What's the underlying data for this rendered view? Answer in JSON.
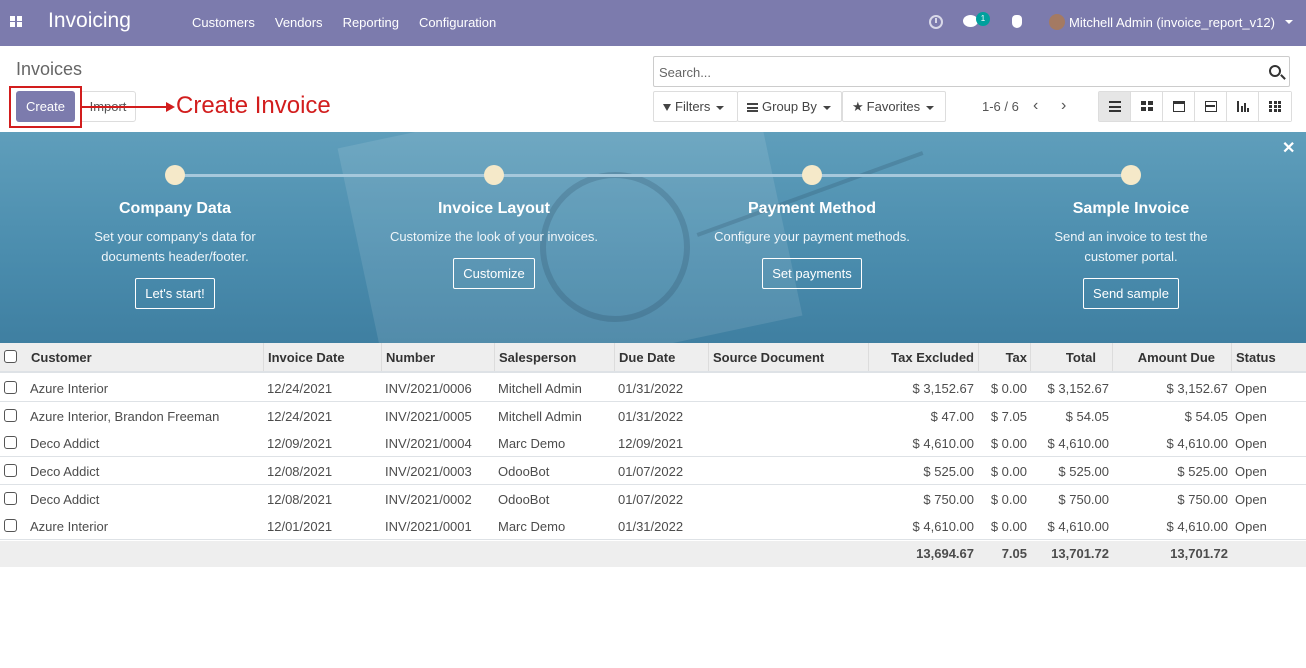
{
  "navbar": {
    "app_title": "Invoicing",
    "menu": [
      "Customers",
      "Vendors",
      "Reporting",
      "Configuration"
    ],
    "chat_badge": "1",
    "user": "Mitchell Admin (invoice_report_v12)",
    "bg_color": "#7c7bad"
  },
  "control_panel": {
    "breadcrumb": "Invoices",
    "create_label": "Create",
    "import_label": "Import",
    "annotation": "Create Invoice",
    "annotation_color": "#d21d1d",
    "search_placeholder": "Search...",
    "filters_label": "Filters",
    "groupby_label": "Group By",
    "favorites_label": "Favorites",
    "pager": "1-6 / 6",
    "views": [
      "list",
      "kanban",
      "calendar",
      "pivot",
      "graph",
      "dashboard"
    ],
    "active_view": "list"
  },
  "banner": {
    "steps": [
      {
        "title": "Company Data",
        "desc_line1": "Set your company's data for",
        "desc_line2": "documents header/footer.",
        "button": "Let's start!"
      },
      {
        "title": "Invoice Layout",
        "desc_line1": "Customize the look of your invoices.",
        "desc_line2": "",
        "button": "Customize"
      },
      {
        "title": "Payment Method",
        "desc_line1": "Configure your payment methods.",
        "desc_line2": "",
        "button": "Set payments"
      },
      {
        "title": "Sample Invoice",
        "desc_line1": "Send an invoice to test the",
        "desc_line2": "customer portal.",
        "button": "Send sample"
      }
    ]
  },
  "table": {
    "headers": [
      "Customer",
      "Invoice Date",
      "Number",
      "Salesperson",
      "Due Date",
      "Source Document",
      "Tax Excluded",
      "Tax",
      "Total",
      "Amount Due",
      "Status"
    ],
    "rows": [
      [
        "Azure Interior",
        "12/24/2021",
        "INV/2021/0006",
        "Mitchell Admin",
        "01/31/2022",
        "",
        "$ 3,152.67",
        "$ 0.00",
        "$ 3,152.67",
        "$ 3,152.67",
        "Open"
      ],
      [
        "Azure Interior, Brandon Freeman",
        "12/24/2021",
        "INV/2021/0005",
        "Mitchell Admin",
        "01/31/2022",
        "",
        "$ 47.00",
        "$ 7.05",
        "$ 54.05",
        "$ 54.05",
        "Open"
      ],
      [
        "Deco Addict",
        "12/09/2021",
        "INV/2021/0004",
        "Marc Demo",
        "12/09/2021",
        "",
        "$ 4,610.00",
        "$ 0.00",
        "$ 4,610.00",
        "$ 4,610.00",
        "Open"
      ],
      [
        "Deco Addict",
        "12/08/2021",
        "INV/2021/0003",
        "OdooBot",
        "01/07/2022",
        "",
        "$ 525.00",
        "$ 0.00",
        "$ 525.00",
        "$ 525.00",
        "Open"
      ],
      [
        "Deco Addict",
        "12/08/2021",
        "INV/2021/0002",
        "OdooBot",
        "01/07/2022",
        "",
        "$ 750.00",
        "$ 0.00",
        "$ 750.00",
        "$ 750.00",
        "Open"
      ],
      [
        "Azure Interior",
        "12/01/2021",
        "INV/2021/0001",
        "Marc Demo",
        "01/31/2022",
        "",
        "$ 4,610.00",
        "$ 0.00",
        "$ 4,610.00",
        "$ 4,610.00",
        "Open"
      ]
    ],
    "totals": {
      "tax_excluded": "13,694.67",
      "tax": "7.05",
      "total": "13,701.72",
      "amount_due": "13,701.72"
    }
  }
}
